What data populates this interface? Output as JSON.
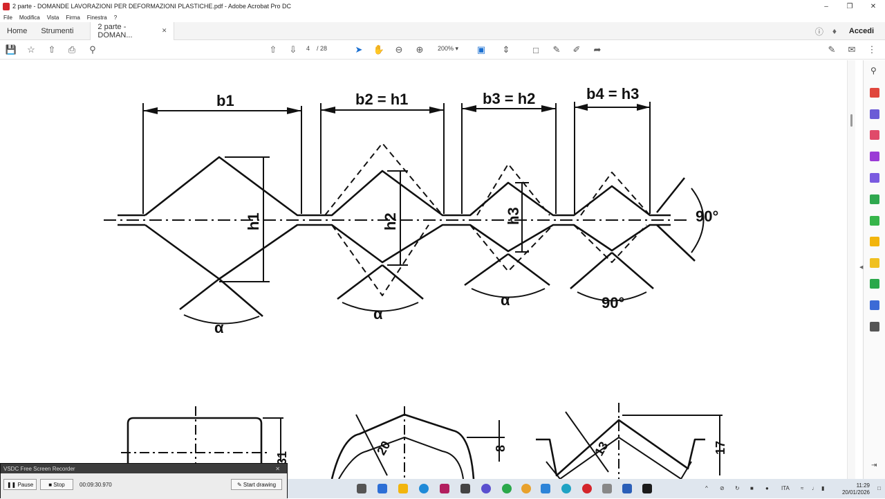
{
  "window": {
    "title": "2 parte - DOMANDE LAVORAZIONI PER DEFORMAZIONI PLASTICHE.pdf - Adobe Acrobat Pro DC"
  },
  "menu": [
    "File",
    "Modifica",
    "Vista",
    "Firma",
    "Finestra",
    "?"
  ],
  "tabs": {
    "home": "Home",
    "tools": "Strumenti",
    "document": "2 parte - DOMAN..."
  },
  "header": {
    "login": "Accedi"
  },
  "toolbar": {
    "page_current": "4",
    "page_total": "/ 28",
    "zoom": "200%"
  },
  "drawing": {
    "labels": {
      "b1": "b1",
      "b2": "b2 = h1",
      "b3": "b3 = h2",
      "b4": "b4 = h3",
      "h1": "h1",
      "h2": "h2",
      "h3": "h3",
      "angle_right": "90°",
      "alpha1": "α",
      "alpha2": "α",
      "alpha3": "α",
      "angle_bottom": "90°",
      "dim31": "31",
      "dim20": "20",
      "dim8": "8",
      "dim13": "13",
      "dim17": "17"
    }
  },
  "recorder": {
    "title": "VSDC Free Screen Recorder",
    "pause": "Pause",
    "stop": "Stop",
    "time": "00:09:30.970",
    "draw": "Start drawing"
  },
  "taskbar": {
    "lang": "ITA",
    "time": "11:29",
    "date": "20/01/2026"
  }
}
